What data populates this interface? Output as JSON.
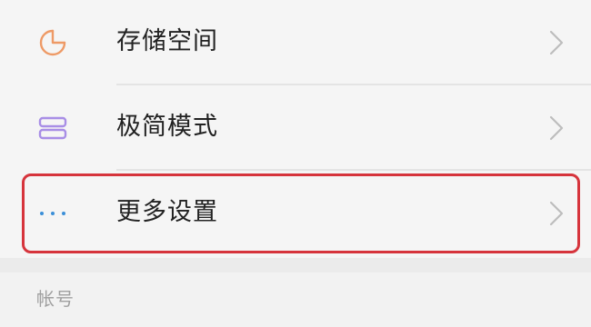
{
  "settings": {
    "items": [
      {
        "label": "存储空间",
        "icon": "storage-pie-icon",
        "icon_color": "#ee9a66"
      },
      {
        "label": "极简模式",
        "icon": "simple-mode-icon",
        "icon_color": "#a88ee6"
      },
      {
        "label": "更多设置",
        "icon": "more-dots-icon",
        "icon_color": "#3b8fd8",
        "highlighted": true
      }
    ]
  },
  "section": {
    "title": "帐号"
  },
  "colors": {
    "highlight_border": "#d6343c",
    "chevron": "#bdbdbd",
    "label_text": "#222222",
    "section_title": "#a0a0a0"
  }
}
